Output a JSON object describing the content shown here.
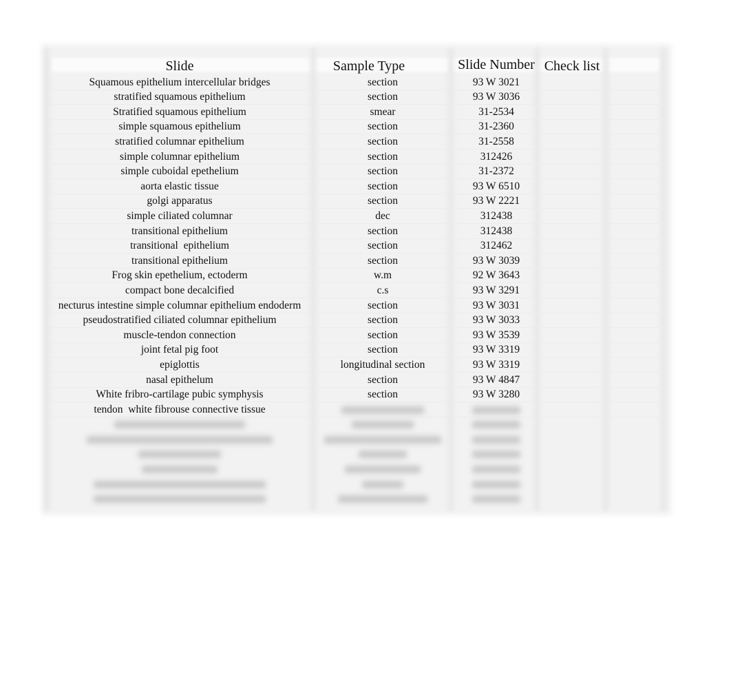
{
  "table": {
    "headers": {
      "slide": "Slide",
      "sample_type": "Sample Type",
      "slide_number": "Slide Number",
      "check_list": "Check list"
    },
    "rows": [
      {
        "slide": "Squamous epithelium intercellular bridges",
        "sample_type": "section",
        "slide_number": "93 W 3021",
        "check": ""
      },
      {
        "slide": "stratified squamous epithelium",
        "sample_type": "section",
        "slide_number": "93 W 3036",
        "check": ""
      },
      {
        "slide": "Stratified squamous epithelium",
        "sample_type": "smear",
        "slide_number": "31-2534",
        "check": ""
      },
      {
        "slide": "simple squamous epithelium",
        "sample_type": "section",
        "slide_number": "31-2360",
        "check": ""
      },
      {
        "slide": "stratified columnar epithelium",
        "sample_type": "section",
        "slide_number": "31-2558",
        "check": ""
      },
      {
        "slide": "simple columnar epithelium",
        "sample_type": "section",
        "slide_number": "312426",
        "check": ""
      },
      {
        "slide": "simple cuboidal epethelium",
        "sample_type": "section",
        "slide_number": "31-2372",
        "check": ""
      },
      {
        "slide": "aorta elastic tissue",
        "sample_type": "section",
        "slide_number": "93 W 6510",
        "check": ""
      },
      {
        "slide": "golgi apparatus",
        "sample_type": "section",
        "slide_number": "93 W 2221",
        "check": ""
      },
      {
        "slide": "simple ciliated columnar",
        "sample_type": "dec",
        "slide_number": "312438",
        "check": ""
      },
      {
        "slide": "transitional epithelium",
        "sample_type": "section",
        "slide_number": "312438",
        "check": ""
      },
      {
        "slide": "transitional  epithelium",
        "sample_type": "section",
        "slide_number": "312462",
        "check": ""
      },
      {
        "slide": "transitional epithelium",
        "sample_type": "section",
        "slide_number": "93 W 3039",
        "check": ""
      },
      {
        "slide": "Frog skin epethelium, ectoderm",
        "sample_type": "w.m",
        "slide_number": "92 W 3643",
        "check": ""
      },
      {
        "slide": "compact bone decalcified",
        "sample_type": "c.s",
        "slide_number": "93 W 3291",
        "check": ""
      },
      {
        "slide": "necturus intestine simple columnar epithelium endoderm",
        "sample_type": "section",
        "slide_number": "93 W 3031",
        "check": ""
      },
      {
        "slide": "pseudostratified ciliated columnar epithelium",
        "sample_type": "section",
        "slide_number": "93 W 3033",
        "check": ""
      },
      {
        "slide": "muscle-tendon connection",
        "sample_type": "section",
        "slide_number": "93 W 3539",
        "check": ""
      },
      {
        "slide": "joint fetal pig foot",
        "sample_type": "section",
        "slide_number": "93 W 3319",
        "check": ""
      },
      {
        "slide": "epiglottis",
        "sample_type": "longitudinal section",
        "slide_number": "93 W 3319",
        "check": ""
      },
      {
        "slide": "nasal epithelum",
        "sample_type": "section",
        "slide_number": "93 W 4847",
        "check": ""
      },
      {
        "slide": "White fribro-cartilage pubic symphysis",
        "sample_type": "section",
        "slide_number": "93 W 3280",
        "check": ""
      },
      {
        "slide": "tendon  white fibrouse connective tissue",
        "sample_type": "",
        "slide_number": "",
        "check": ""
      }
    ],
    "blurred_rows_count": 7
  }
}
